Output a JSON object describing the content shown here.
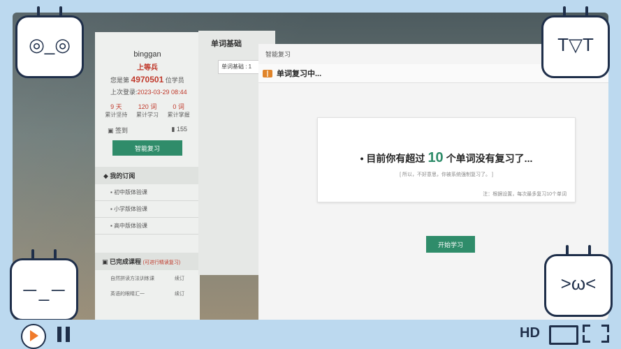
{
  "profile": {
    "name": "binggan",
    "rank": "上等兵",
    "rank_line_prefix": "您是第",
    "rank_number": "4970501",
    "rank_line_suffix": "位学员",
    "last_login_label": "上次登录:",
    "last_login_date": "2023-03-29 08:44",
    "stats": [
      {
        "value": "9 天",
        "label": "累计坚持"
      },
      {
        "value": "120 词",
        "label": "累计学习"
      },
      {
        "value": "0 词",
        "label": "累计掌握"
      }
    ],
    "sign_label": "签到",
    "coins": "155",
    "review_button": "智能复习",
    "subs_title": "我的订阅",
    "courses": [
      "初中版体验课",
      "小学版体验课",
      "高中版体验课"
    ],
    "done_title": "已完成课程",
    "done_note": "(可进行精读复习)",
    "done_items": [
      {
        "name": "自然拼读方法训练课",
        "action": "续订"
      },
      {
        "name": "英语的眼睛汇一",
        "action": "续订"
      }
    ]
  },
  "mid": {
    "title": "单词基础",
    "select_value": "单词基础 : 1"
  },
  "modal": {
    "crumb": "智能复习",
    "header": "单词复习中...",
    "msg_prefix": "• 目前你有超过",
    "msg_number": "10",
    "msg_suffix": "个单词没有复习了...",
    "sub": "[ 所以，不好意思，你被系统强制复习了。 ]",
    "note": "注：根据设置，每次最多复习10个单词",
    "start_button": "开始学习"
  },
  "player": {
    "hd": "HD"
  },
  "colors": {
    "accent": "#2f8c6a",
    "highlight": "#c0392b",
    "frame": "#bcd9ef"
  }
}
